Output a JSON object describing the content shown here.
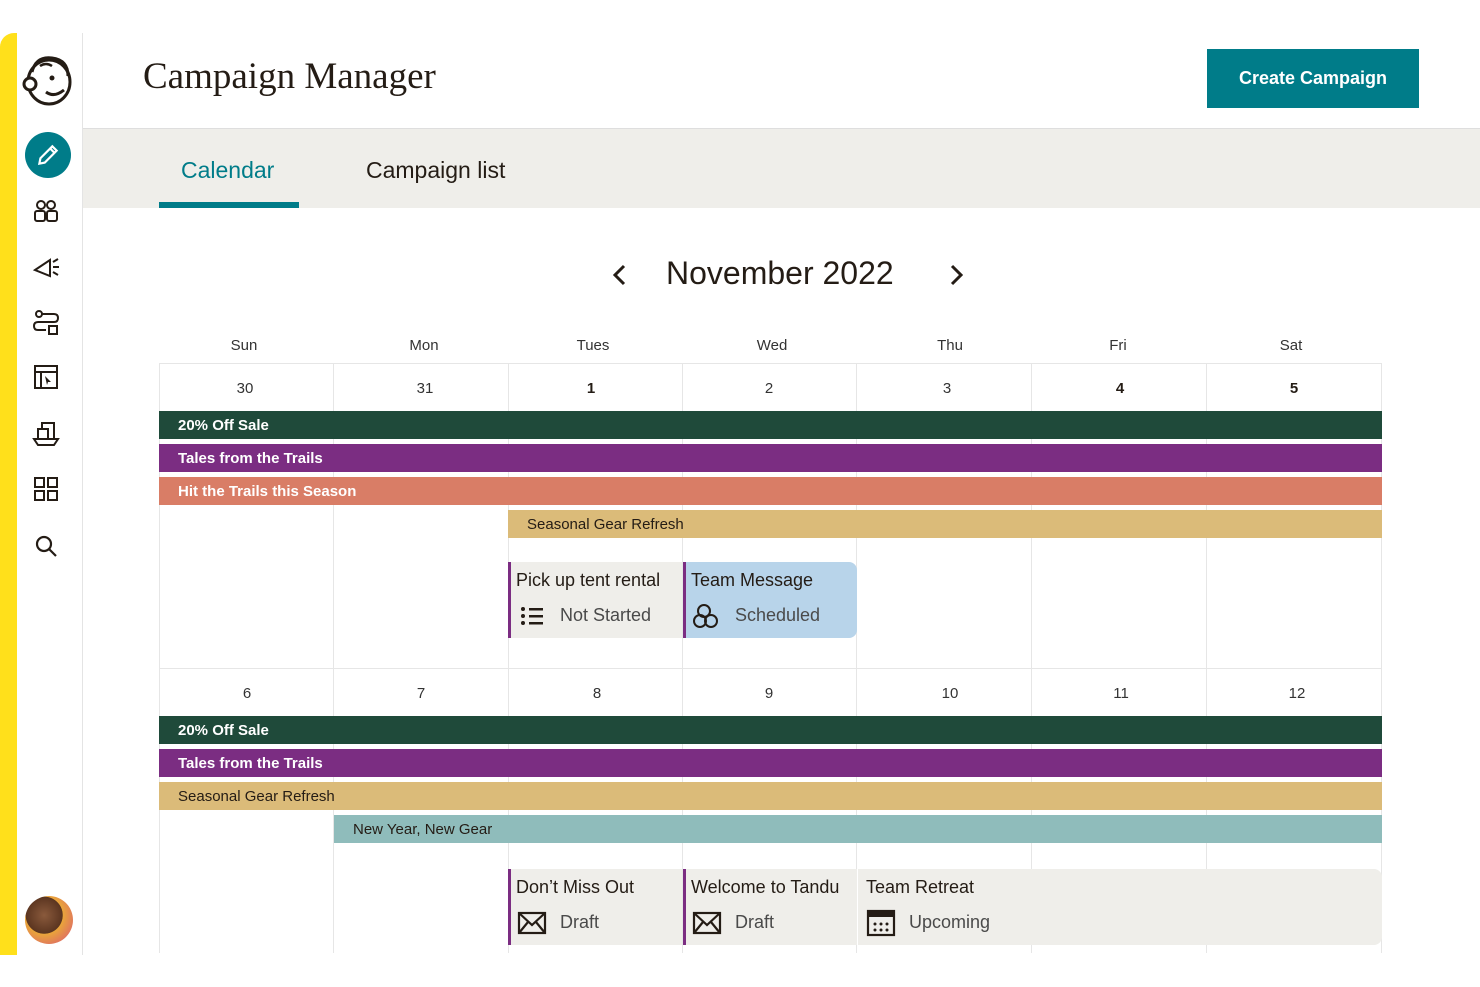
{
  "header": {
    "title": "Campaign Manager",
    "create_button": "Create Campaign"
  },
  "tabs": [
    {
      "label": "Calendar",
      "active": true
    },
    {
      "label": "Campaign list",
      "active": false
    }
  ],
  "sidebar": {
    "items": [
      {
        "icon": "pencil-icon",
        "active": true
      },
      {
        "icon": "audience-icon"
      },
      {
        "icon": "megaphone-icon"
      },
      {
        "icon": "automations-icon"
      },
      {
        "icon": "website-icon"
      },
      {
        "icon": "content-icon"
      },
      {
        "icon": "integrations-grid-icon"
      },
      {
        "icon": "search-icon"
      }
    ],
    "colors": {
      "accent": "#007c89",
      "brand_bar": "#ffe01b"
    }
  },
  "calendar": {
    "month_label": "November 2022",
    "day_headers": [
      "Sun",
      "Mon",
      "Tues",
      "Wed",
      "Thu",
      "Fri",
      "Sat"
    ],
    "weeks": [
      {
        "dates": [
          "30",
          "31",
          "1",
          "2",
          "3",
          "4",
          "5"
        ],
        "bars": [
          {
            "label": "20% Off Sale",
            "color": "#1f4a3a"
          },
          {
            "label": "Tales from the Trails",
            "color": "#7b2d82"
          },
          {
            "label": "Hit the Trails this Season",
            "color": "#d97d66"
          },
          {
            "label": "Seasonal Gear Refresh",
            "color": "#dbbb79"
          }
        ],
        "cards": [
          {
            "title": "Pick up tent rental",
            "status": "Not Started",
            "icon": "checklist-icon"
          },
          {
            "title": "Team Message",
            "status": "Scheduled",
            "icon": "scheduled-icon"
          }
        ]
      },
      {
        "dates": [
          "6",
          "7",
          "8",
          "9",
          "10",
          "11",
          "12"
        ],
        "bars": [
          {
            "label": "20% Off Sale",
            "color": "#1f4a3a"
          },
          {
            "label": "Tales from the Trails",
            "color": "#7b2d82"
          },
          {
            "label": "Seasonal Gear Refresh",
            "color": "#dbbb79"
          },
          {
            "label": "New Year, New Gear",
            "color": "#8fbcbb"
          }
        ],
        "cards": [
          {
            "title": "Don’t Miss Out",
            "status": "Draft",
            "icon": "envelope-icon"
          },
          {
            "title": "Welcome to Tandu",
            "status": "Draft",
            "icon": "envelope-icon"
          },
          {
            "title": "Team Retreat",
            "status": "Upcoming",
            "icon": "calendar-icon"
          }
        ]
      }
    ]
  }
}
